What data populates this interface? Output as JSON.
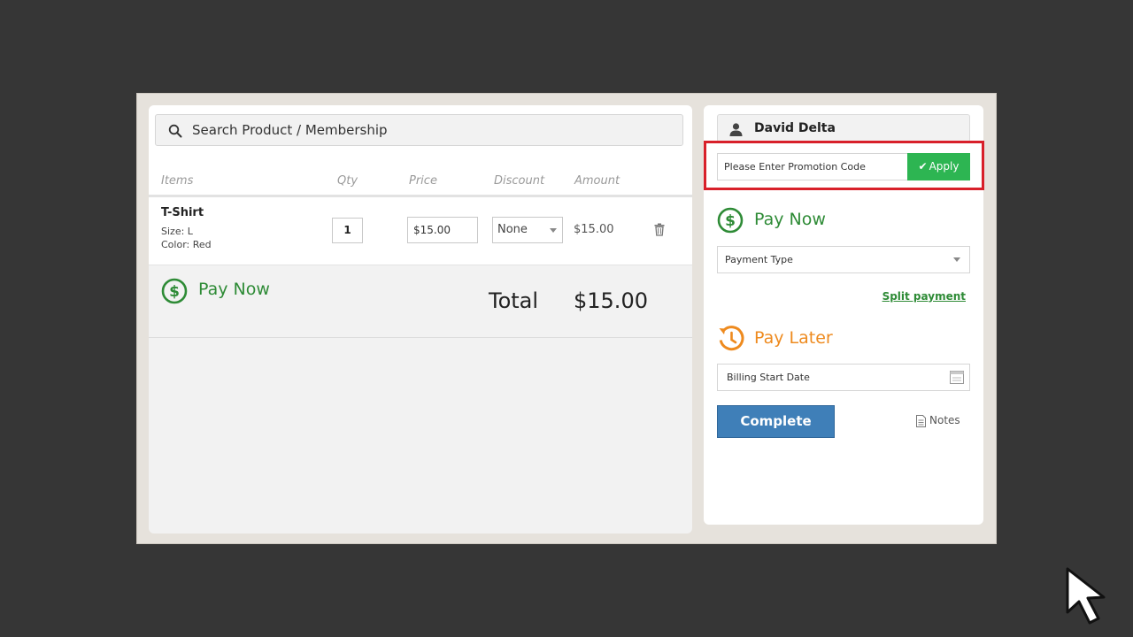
{
  "search": {
    "placeholder": "Search Product / Membership"
  },
  "table": {
    "headers": [
      "Items",
      "Qty",
      "Price",
      "Discount",
      "Amount"
    ],
    "row": {
      "name": "T-Shirt",
      "size": "Size: L",
      "color": "Color: Red",
      "qty": "1",
      "price": "$15.00",
      "discount": "None",
      "amount": "$15.00"
    }
  },
  "left_pay": {
    "label": "Pay Now"
  },
  "total": {
    "label": "Total",
    "value": "$15.00"
  },
  "customer": {
    "name": "David Delta"
  },
  "promo": {
    "placeholder": "Please Enter Promotion Code",
    "apply_label": "Apply"
  },
  "right_pay": {
    "pay_now_label": "Pay Now",
    "payment_type_placeholder": "Payment Type",
    "split_label": "Split payment",
    "pay_later_label": "Pay Later",
    "billing_placeholder": "Billing Start Date",
    "complete_label": "Complete",
    "notes_label": "Notes"
  },
  "colors": {
    "pay_now_green": "#2e8b36",
    "pay_later_orange": "#ee8a1e",
    "apply_green": "#2db552",
    "complete_blue": "#3f7fb8",
    "highlight_red": "#d8202a"
  },
  "icons": [
    "search-icon",
    "trash-icon",
    "dollar-circle-icon",
    "user-icon",
    "check-icon",
    "chevron-down-icon",
    "history-clock-icon",
    "calendar-icon",
    "document-icon",
    "mouse-cursor-icon"
  ]
}
